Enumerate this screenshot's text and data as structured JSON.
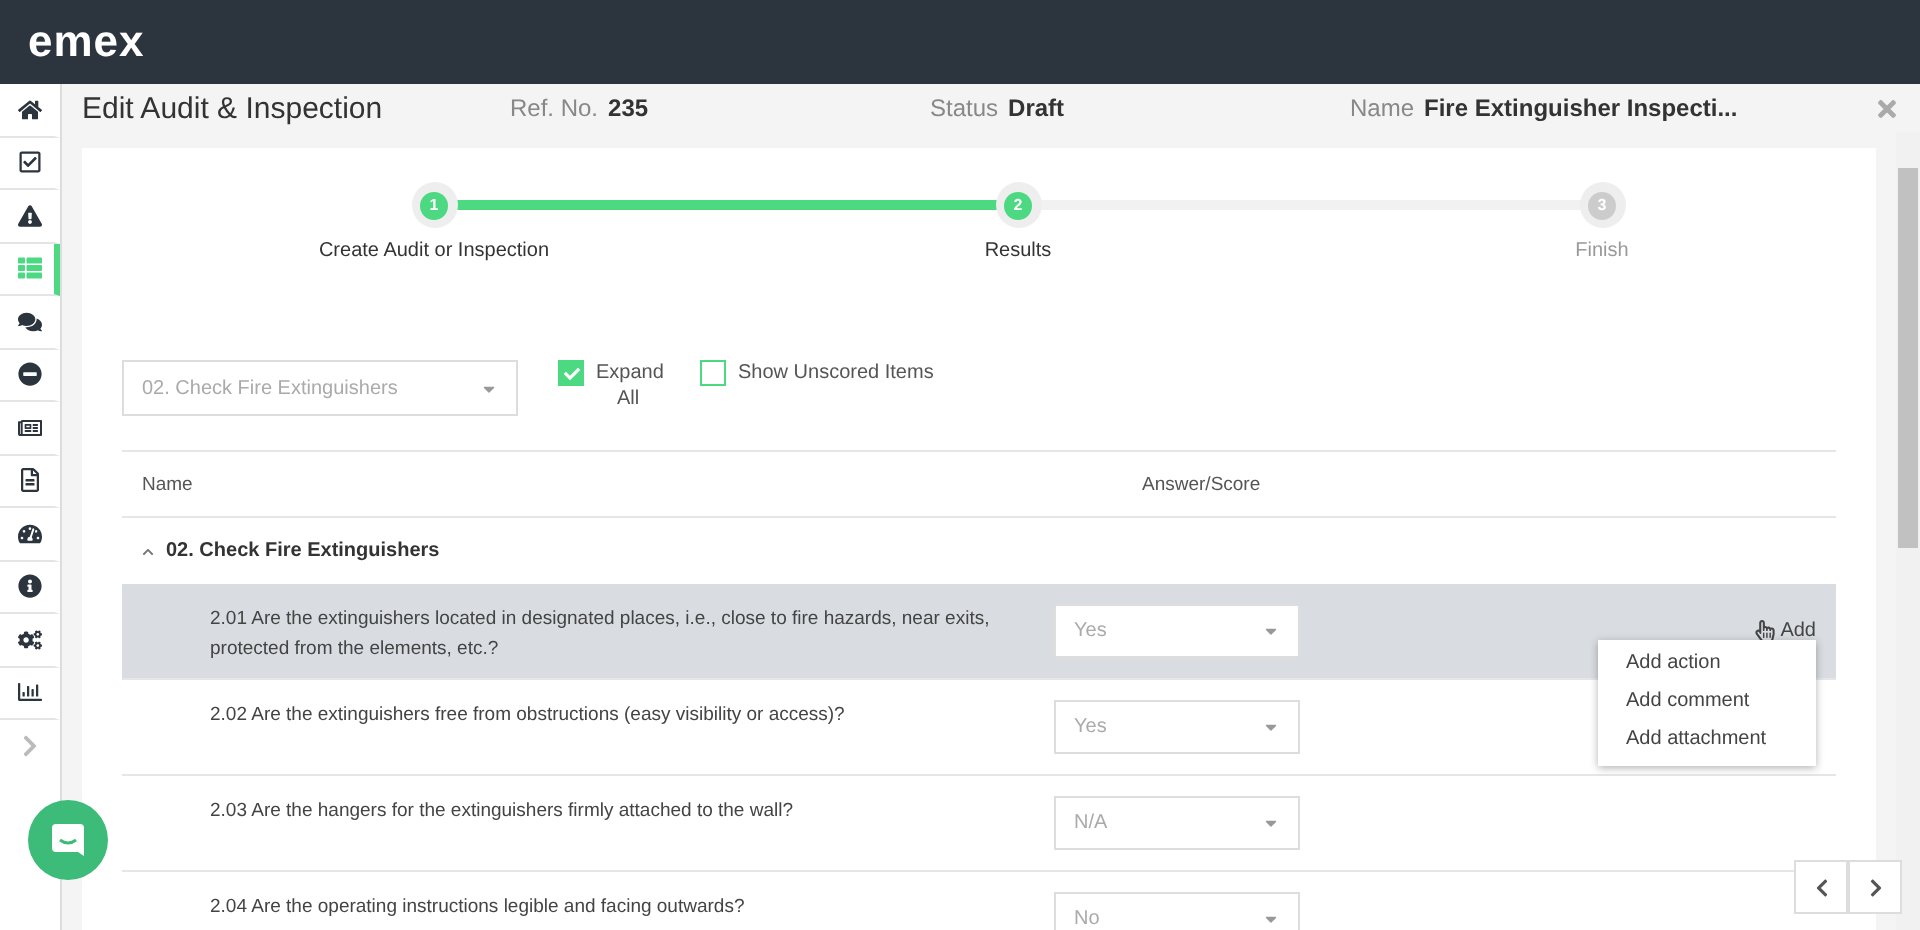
{
  "logo": "emex",
  "sidebar": {
    "items": [
      {
        "kind": "home",
        "selected": false
      },
      {
        "kind": "checkbox",
        "selected": false
      },
      {
        "kind": "warning",
        "selected": false
      },
      {
        "kind": "list",
        "selected": true
      },
      {
        "kind": "comments",
        "selected": false
      },
      {
        "kind": "minus",
        "selected": false
      },
      {
        "kind": "card",
        "selected": false
      },
      {
        "kind": "file",
        "selected": false
      },
      {
        "kind": "gauge",
        "selected": false
      },
      {
        "kind": "info",
        "selected": false
      },
      {
        "kind": "cogs",
        "selected": false
      },
      {
        "kind": "chart",
        "selected": false
      },
      {
        "kind": "expand",
        "selected": false
      }
    ]
  },
  "header": {
    "title": "Edit Audit & Inspection",
    "ref_label": "Ref. No.",
    "ref_value": "235",
    "status_label": "Status",
    "status_value": "Draft",
    "name_label": "Name",
    "name_value": "Fire Extinguisher Inspecti..."
  },
  "stepper": [
    {
      "number": "1",
      "label": "Create Audit or Inspection",
      "reached": true
    },
    {
      "number": "2",
      "label": "Results",
      "reached": true
    },
    {
      "number": "3",
      "label": "Finish",
      "reached": false
    }
  ],
  "filters": {
    "section_select": {
      "value": "02. Check Fire Extinguishers"
    },
    "expand_all": {
      "label": "Expand All",
      "checked": true
    },
    "show_unscored": {
      "label": "Show Unscored Items",
      "checked": false
    }
  },
  "table": {
    "columns": [
      "Name",
      "Answer/Score"
    ],
    "group": {
      "label": "02. Check Fire Extinguishers",
      "expanded": true
    },
    "rows": [
      {
        "question": "2.01 Are the extinguishers located in designated places, i.e., close to fire hazards, near exits, protected from the elements, etc.?",
        "answer": "Yes",
        "highlighted": true,
        "add": {
          "label": "Add",
          "menu": [
            "Add action",
            "Add comment",
            "Add attachment"
          ]
        }
      },
      {
        "question": "2.02 Are the extinguishers free from obstructions (easy visibility or access)?",
        "answer": "Yes",
        "highlighted": false
      },
      {
        "question": "2.03 Are the hangers for the extinguishers firmly attached to the wall?",
        "answer": "N/A",
        "highlighted": false
      },
      {
        "question": "2.04 Are the operating instructions legible and facing outwards?",
        "answer": "No",
        "highlighted": false
      }
    ]
  }
}
